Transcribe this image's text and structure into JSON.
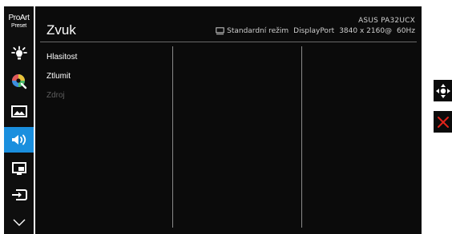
{
  "sidebar": {
    "brand_line1": "ProArt",
    "brand_line2": "Preset",
    "items": [
      {
        "icon": "brightness-icon"
      },
      {
        "icon": "color-icon"
      },
      {
        "icon": "image-icon"
      },
      {
        "icon": "sound-icon",
        "active": true
      },
      {
        "icon": "pip-icon"
      },
      {
        "icon": "input-icon"
      },
      {
        "icon": "chevron-down-icon"
      }
    ]
  },
  "header": {
    "title": "Zvuk",
    "model": "ASUS PA32UCX",
    "mode": "Standardní režim",
    "port": "DisplayPort",
    "resolution": "3840 x 2160@",
    "refresh": "60Hz"
  },
  "menu": {
    "items": [
      {
        "label": "Hlasitost",
        "enabled": true
      },
      {
        "label": "Ztlumit",
        "enabled": true
      },
      {
        "label": "Zdroj",
        "enabled": false
      }
    ]
  },
  "colors": {
    "accent": "#1a8fde",
    "exit": "#e2231a",
    "background": "#0b0b0b"
  },
  "nav": {
    "move_icon": "move-dpad-icon",
    "exit_icon": "close-icon"
  }
}
